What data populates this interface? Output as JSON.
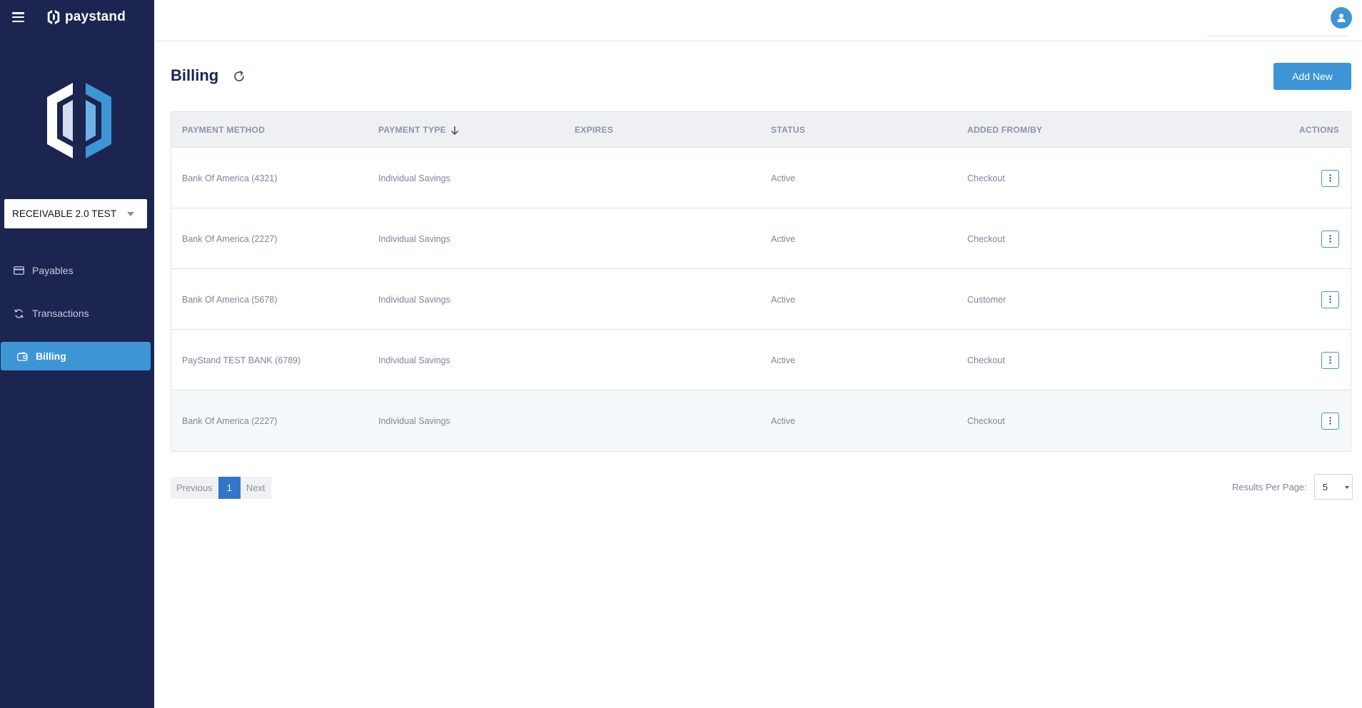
{
  "brand": {
    "name": "paystand"
  },
  "colors": {
    "sidebar": "#1b2550",
    "accent": "#3e95d5",
    "pager_current": "#3176c8"
  },
  "sidebar": {
    "entity_select": "RECEIVABLE 2.0 TEST",
    "items": [
      {
        "label": "Payables",
        "icon": "credit-card-icon",
        "active": false
      },
      {
        "label": "Transactions",
        "icon": "refresh-icon",
        "active": false
      },
      {
        "label": "Billing",
        "icon": "wallet-icon",
        "active": true
      }
    ]
  },
  "header": {
    "title": "Billing",
    "add_new": "Add New"
  },
  "table": {
    "columns": [
      "PAYMENT METHOD",
      "PAYMENT TYPE",
      "EXPIRES",
      "STATUS",
      "ADDED FROM/BY",
      "ACTIONS"
    ],
    "sort": {
      "column": "PAYMENT TYPE",
      "direction": "descending"
    },
    "rows": [
      {
        "method": "Bank Of America (4321)",
        "type": "Individual Savings",
        "expires": "",
        "status": "Active",
        "added": "Checkout"
      },
      {
        "method": "Bank Of America (2227)",
        "type": "Individual Savings",
        "expires": "",
        "status": "Active",
        "added": "Checkout"
      },
      {
        "method": "Bank Of America (5678)",
        "type": "Individual Savings",
        "expires": "",
        "status": "Active",
        "added": "Customer"
      },
      {
        "method": "PayStand TEST BANK (6789)",
        "type": "Individual Savings",
        "expires": "",
        "status": "Active",
        "added": "Checkout"
      },
      {
        "method": "Bank Of America (2227)",
        "type": "Individual Savings",
        "expires": "",
        "status": "Active",
        "added": "Checkout"
      }
    ]
  },
  "pagination": {
    "previous": "Previous",
    "current": "1",
    "next": "Next"
  },
  "results_per_page": {
    "label": "Results Per Page:",
    "value": "5"
  }
}
